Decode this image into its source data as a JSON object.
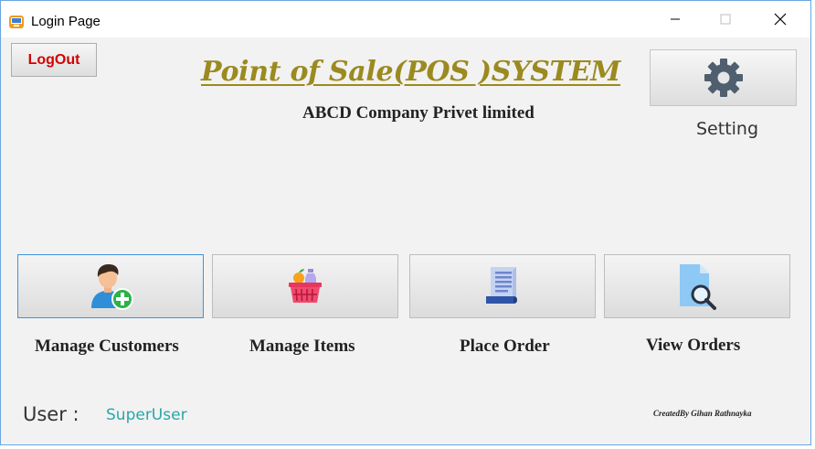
{
  "window": {
    "title": "Login Page"
  },
  "header": {
    "logout_label": "LogOut",
    "system_title": "Point of Sale(POS )SYSTEM",
    "company_name": "ABCD Company Privet limited",
    "setting_label": "Setting"
  },
  "tiles": [
    {
      "label": "Manage Customers",
      "icon": "customer-add-icon"
    },
    {
      "label": "Manage Items",
      "icon": "shopping-basket-icon"
    },
    {
      "label": "Place Order",
      "icon": "order-document-icon"
    },
    {
      "label": "View Orders",
      "icon": "document-search-icon"
    }
  ],
  "footer": {
    "user_label": "User :",
    "user_value": "SuperUser",
    "credit": "CreatedBy Gihan Rathnayka"
  },
  "colors": {
    "title_gold": "#9b8a1f",
    "logout_red": "#d40000",
    "user_teal": "#2aa7a7",
    "active_border": "#3e94dd"
  }
}
